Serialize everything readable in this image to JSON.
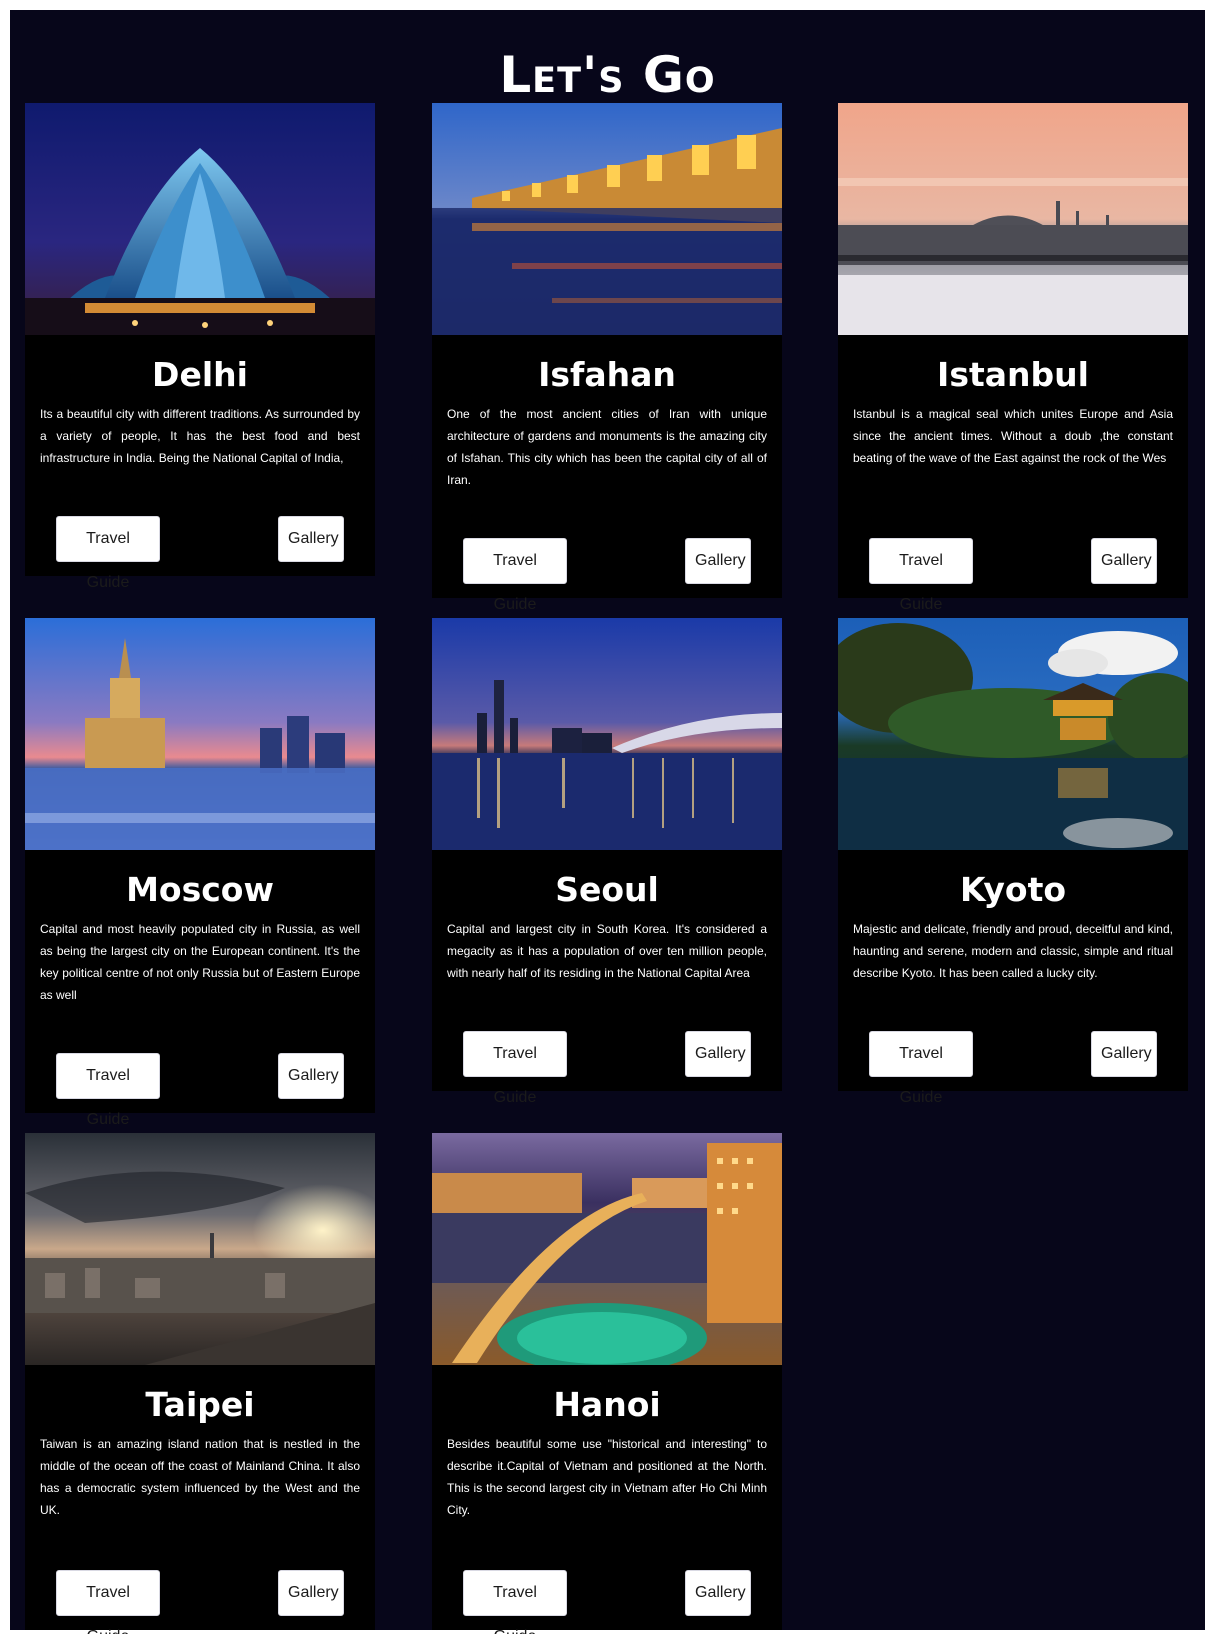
{
  "page": {
    "title": "Let's Go"
  },
  "colors": {
    "background": "#07061a",
    "card": "#000000",
    "text": "#ffffff",
    "button_bg": "#ffffff",
    "button_text": "#1b1b1b"
  },
  "cards": [
    {
      "city": "Delhi",
      "description": "Its a beautiful city with different traditions. As surrounded by a variety of people, It has the best food and best infrastructure in India. Being the National Capital of India,",
      "guide_label": "Travel Guide",
      "gallery_label": "Gallery"
    },
    {
      "city": "Isfahan",
      "description": "One of the most ancient cities of Iran with unique architecture of gardens and monuments is the amazing city of Isfahan. This city which has been the capital city of all of Iran.",
      "guide_label": "Travel Guide",
      "gallery_label": "Gallery"
    },
    {
      "city": "Istanbul",
      "description": "Istanbul is a magical seal which unites Europe and Asia since the ancient times. Without a doub ,the constant beating of the wave of the East against the rock of the Wes",
      "guide_label": "Travel Guide",
      "gallery_label": "Gallery"
    },
    {
      "city": "Moscow",
      "description": "Capital and most heavily populated city in Russia, as well as being the largest city on the European continent. It's the key political centre of not only Russia but of Eastern Europe as well",
      "guide_label": "Travel Guide",
      "gallery_label": "Gallery"
    },
    {
      "city": "Seoul",
      "description": "Capital and largest city in South Korea. It's considered a megacity as it has a population of over ten million people, with nearly half of its residing in the National Capital Area",
      "guide_label": "Travel Guide",
      "gallery_label": "Gallery"
    },
    {
      "city": "Kyoto",
      "description": "Majestic and delicate, friendly and proud, deceitful and kind, haunting and serene, modern and classic, simple and ritual describe Kyoto. It has been called a lucky city.",
      "guide_label": "Travel Guide",
      "gallery_label": "Gallery"
    },
    {
      "city": "Taipei",
      "description": "Taiwan is an amazing island nation that is nestled in the middle of the ocean off the coast of Mainland China. It also has a democratic system influenced by the West and the UK.",
      "guide_label": "Travel Guide",
      "gallery_label": "Gallery"
    },
    {
      "city": "Hanoi",
      "description": "Besides beautiful some use \"historical and interesting\" to describe it.Capital of Vietnam and positioned at the North. This is the second largest city in Vietnam after Ho Chi Minh City.",
      "guide_label": "Travel Guide",
      "gallery_label": "Gallery"
    }
  ]
}
